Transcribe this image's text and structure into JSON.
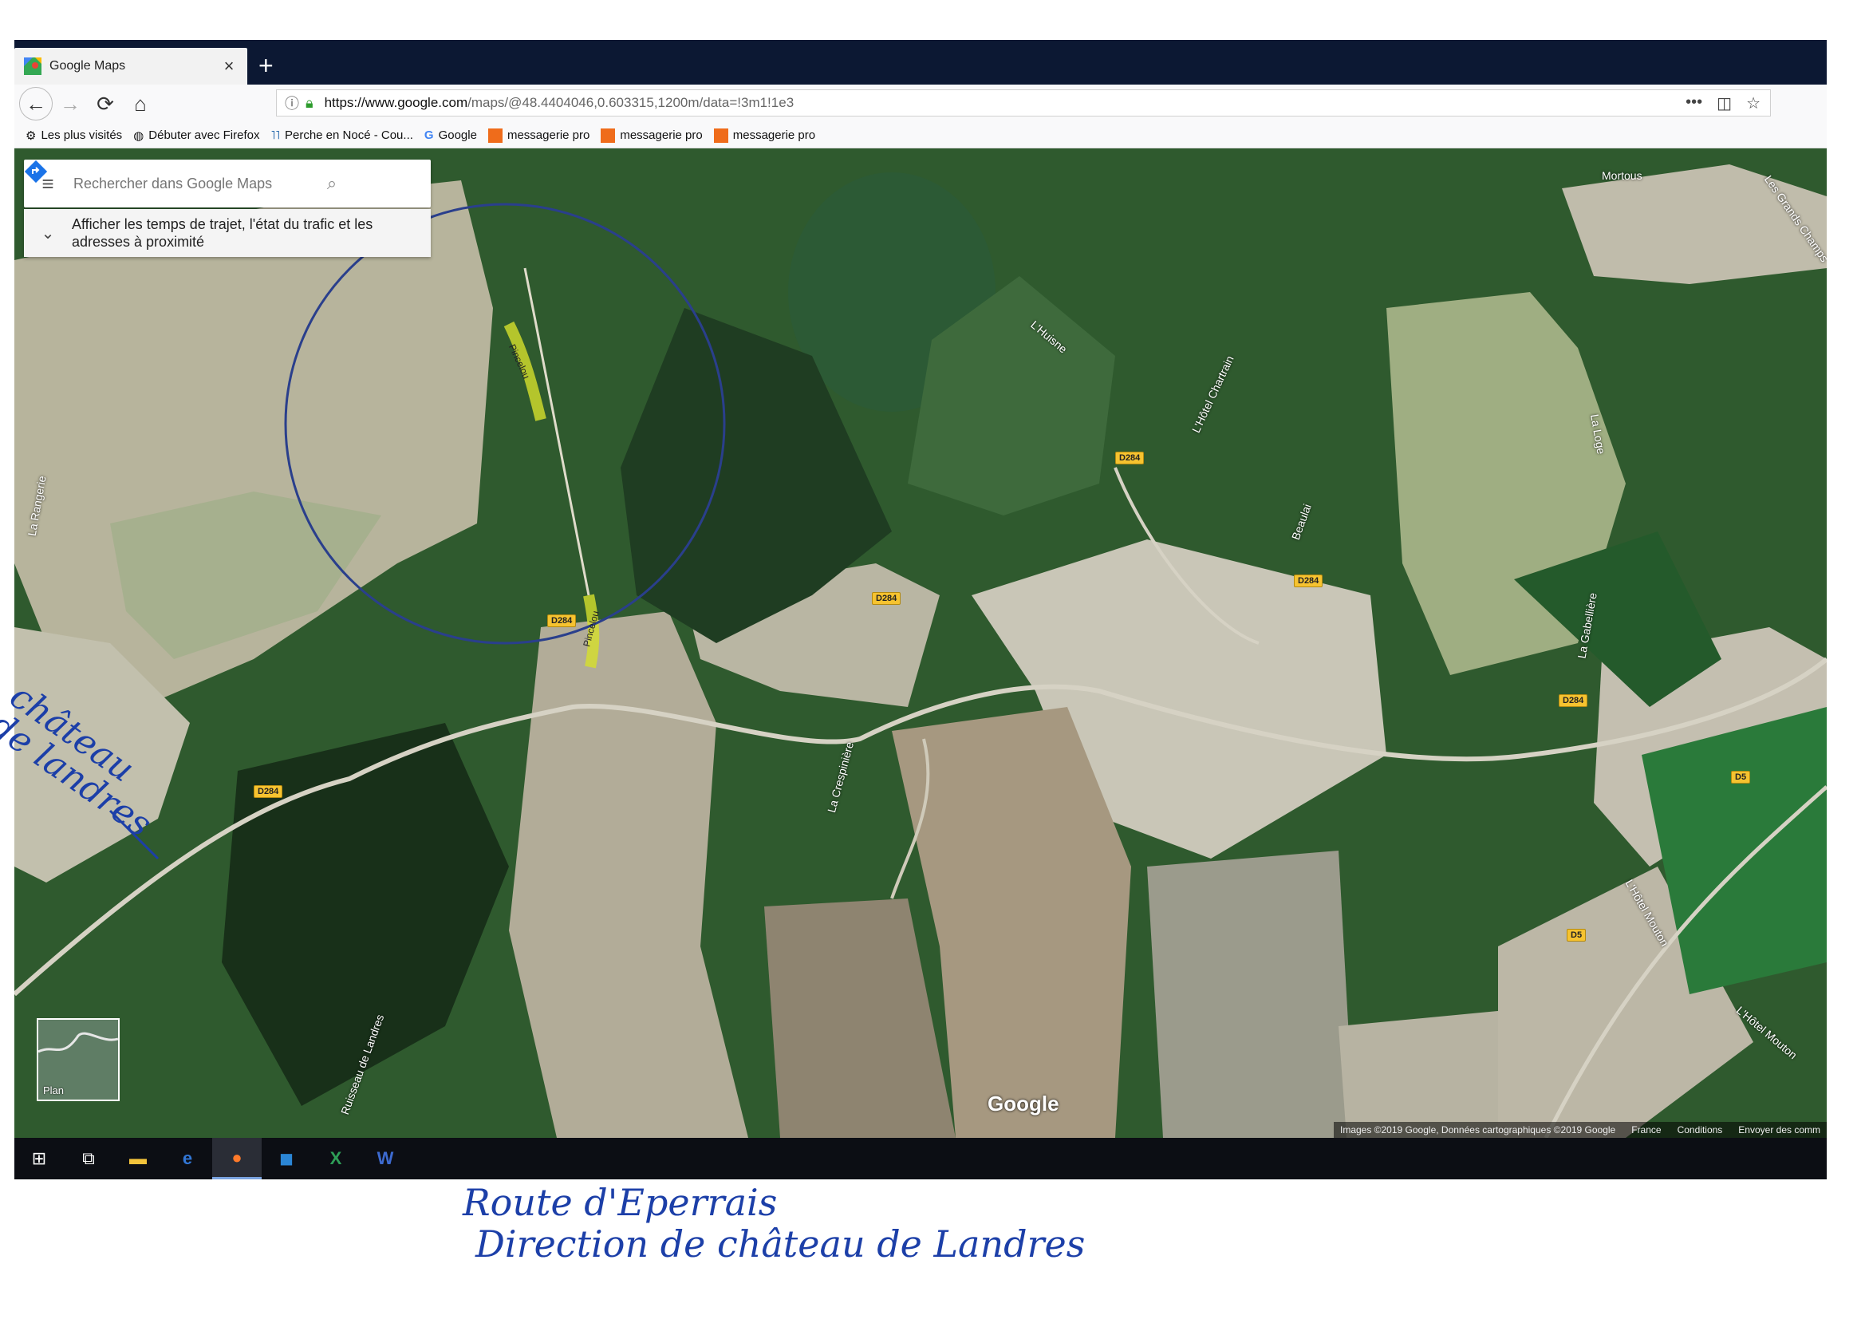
{
  "browser": {
    "tab_title": "Google Maps",
    "url_host": "https://www.google.com",
    "url_path": "/maps/@48.4404046,0.603315,1200m/data=!3m1!1e3",
    "bookmarks": [
      {
        "label": "Les plus visités",
        "icon": "gear-icon"
      },
      {
        "label": "Débuter avec Firefox",
        "icon": "globe-icon"
      },
      {
        "label": "Perche en Nocé - Cou...",
        "icon": "site-icon"
      },
      {
        "label": "Google",
        "icon": "google-icon"
      },
      {
        "label": "messagerie pro",
        "icon": "orange-icon"
      },
      {
        "label": "messagerie pro",
        "icon": "orange-icon"
      },
      {
        "label": "messagerie pro",
        "icon": "orange-icon"
      }
    ]
  },
  "maps": {
    "search_placeholder": "Rechercher dans Google Maps",
    "traffic_text": "Afficher les temps de trajet, l'état du trafic et les adresses à proximité",
    "plan_label": "Plan",
    "logo": "Google",
    "attribution": [
      "Images ©2019 Google, Données cartographiques ©2019 Google",
      "France",
      "Conditions",
      "Envoyer des comm"
    ],
    "roads": [
      "D284",
      "D284",
      "D284",
      "D284",
      "D284",
      "D284",
      "D5",
      "D5"
    ],
    "places": [
      "Mortous",
      "Les Grands Champs",
      "L'Huisne",
      "L'Hôtel Chartrain",
      "La Loge",
      "Beaulai",
      "La Rangerie",
      "La Crespinière",
      "La Gabellière",
      "L'Hôtel Mouton",
      "L'Hôtel Mouton",
      "Ruisseau de Landres",
      "Pincelou",
      "Pincelou"
    ]
  },
  "annotations": {
    "side_line1": "château",
    "side_line2": "de landres",
    "bottom_line1": "Route d'Eperrais",
    "bottom_line2": "Direction de château de Landres"
  },
  "colors": {
    "handwriting": "#1c3fa8",
    "circle": "#2a3f8c",
    "road_badge": "#f6c330"
  }
}
